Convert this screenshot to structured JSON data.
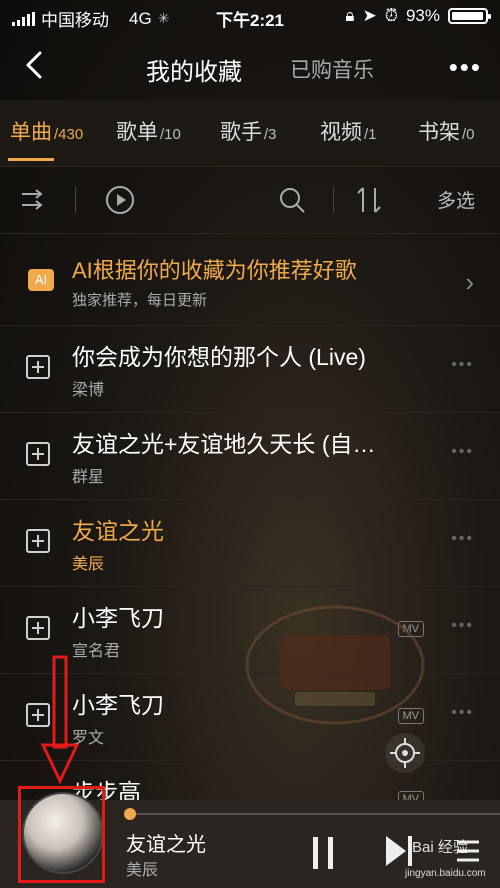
{
  "status_bar": {
    "carrier": "中国移动",
    "network": "4G",
    "time": "下午2:21",
    "battery": "93%"
  },
  "header": {
    "title": "我的收藏",
    "secondary_tab": "已购音乐",
    "more": "•••"
  },
  "tabs": [
    {
      "label": "单曲",
      "count": "/430"
    },
    {
      "label": "歌单",
      "count": "/10"
    },
    {
      "label": "歌手",
      "count": "/3"
    },
    {
      "label": "视频",
      "count": "/1"
    },
    {
      "label": "书架",
      "count": "/0"
    }
  ],
  "toolbar": {
    "multi_select": "多选"
  },
  "ai_recommend": {
    "badge": "AI",
    "title": "AI根据你的收藏为你推荐好歌",
    "subtitle": "独家推荐，每日更新"
  },
  "songs": [
    {
      "title": "你会成为你想的那个人 (Live)",
      "artist": "梁博"
    },
    {
      "title": "友谊之光+友谊地久天长 (自…",
      "artist": "群星"
    },
    {
      "title": "友谊之光",
      "artist": "美辰"
    },
    {
      "title": "小李飞刀",
      "artist": "宣名君",
      "mv": "MV"
    },
    {
      "title": "小李飞刀",
      "artist": "罗文",
      "mv": "MV"
    },
    {
      "title": "步步高",
      "artist": "",
      "mv": "MV"
    }
  ],
  "player": {
    "song": "友谊之光",
    "artist": "美辰",
    "progress": 0.0
  },
  "watermark": {
    "text": "Bai 经验",
    "url": "jingyan.baidu.com"
  },
  "colors": {
    "accent": "#f0a94b",
    "annotation": "#e31a1a"
  }
}
